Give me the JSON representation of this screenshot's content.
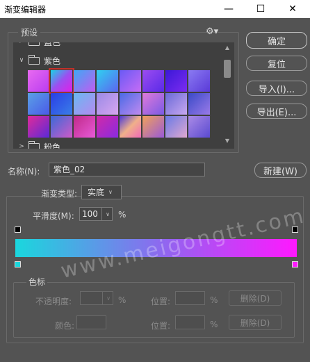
{
  "window": {
    "title": "渐变编辑器",
    "minimize_glyph": "—",
    "maximize_glyph": "☐",
    "close_glyph": "✕"
  },
  "presets": {
    "legend": "预设",
    "menu_icon": "gear-icon",
    "folders": [
      {
        "name": "蓝色",
        "expanded": false
      },
      {
        "name": "紫色",
        "expanded": true
      },
      {
        "name": "粉色",
        "expanded": false
      }
    ],
    "selected_index": 1,
    "swatches": [
      "linear-gradient(135deg,#e86af0,#b93cf0)",
      "linear-gradient(135deg,#19d3e6,#9d4ef0,#e020e8)",
      "linear-gradient(135deg,#3ea8f5,#c15cf0)",
      "linear-gradient(135deg,#2fd0f0,#5d65f0)",
      "linear-gradient(135deg,#6a5af5,#c66cf5)",
      "linear-gradient(135deg,#9b4cf0,#5a2ae8)",
      "linear-gradient(135deg,#3b18d8,#7b2cf0)",
      "linear-gradient(135deg,#8a7af2,#5a3ad8)",
      "linear-gradient(135deg,#5aa0e6,#4a5ae8)",
      "linear-gradient(135deg,#2a3ee6,#3a7ee8)",
      "linear-gradient(135deg,#6ab8f2,#b48af0)",
      "linear-gradient(135deg,#9a8ae6,#d8a6f0)",
      "linear-gradient(135deg,#4a6ae6,#c08af0)",
      "linear-gradient(135deg,#e07ad8,#7a5ae6)",
      "linear-gradient(135deg,#6a6ad8,#c8a8f0)",
      "linear-gradient(135deg,#3a4ac8,#9a7ae8)",
      "linear-gradient(135deg,#e02a9a,#5a2ad8)",
      "linear-gradient(135deg,#3a6ad8,#d05ac8)",
      "linear-gradient(135deg,#c02a8a,#e85ad8)",
      "linear-gradient(135deg,#d02aa8,#8a2ae0)",
      "linear-gradient(135deg,#4a3ad8,#f0b08a,#f06ab8)",
      "linear-gradient(135deg,#f0a05a,#9a5ad8)",
      "linear-gradient(135deg,#6a7ae6,#e0a8d0)",
      "linear-gradient(135deg,#aa8ae6,#5a4ad0)"
    ]
  },
  "buttons": {
    "ok": "确定",
    "reset": "复位",
    "import": "导入(I)...",
    "export": "导出(E)...",
    "new": "新建(W)"
  },
  "name": {
    "label": "名称(N):",
    "value": "紫色_02"
  },
  "gradient": {
    "type_label": "渐变类型:",
    "type_value": "实底",
    "smooth_label": "平滑度(M):",
    "smooth_value": "100",
    "smooth_unit": "%",
    "colors": {
      "left_stop": "#1ad7dd",
      "mid": "#9562f0",
      "right_stop": "#ff18ff"
    }
  },
  "stops": {
    "legend": "色标",
    "opacity_label": "不透明度:",
    "opacity_unit": "%",
    "location_label": "位置:",
    "location_unit": "%",
    "delete_label": "删除(D)",
    "color_label": "颜色:"
  },
  "watermark": "www.meigongtt.com"
}
